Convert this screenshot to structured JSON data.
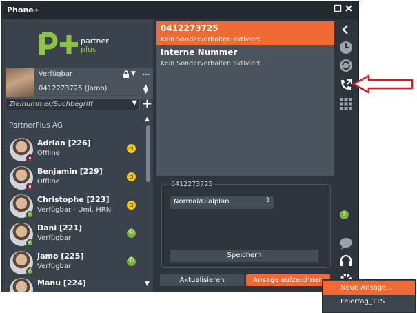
{
  "window": {
    "title": "Phone+",
    "maximize_icon": "maximize-icon",
    "close_icon": "close-icon"
  },
  "logo": {
    "line1": "partner",
    "line2": "plus",
    "colors": {
      "green": "#8bc53f"
    }
  },
  "profile": {
    "status": "Verfügbar",
    "number": "0412273725 (Jamo)",
    "more_label": "..."
  },
  "search": {
    "placeholder": "Zielnummer/Suchbegriff"
  },
  "add_label": "+",
  "group": {
    "label": "PartnerPlus AG"
  },
  "contacts": [
    {
      "name": "Adrian [226]",
      "status": "Offline",
      "presence": "offline",
      "action": "yellow"
    },
    {
      "name": "Benjamin [229]",
      "status": "Offline",
      "presence": "offline",
      "action": "yellow"
    },
    {
      "name": "Christophe [223]",
      "status": "Verfügbar - Uml. HRN",
      "presence": "online",
      "action": "yellow"
    },
    {
      "name": "Dani [221]",
      "status": "Verfügbar",
      "presence": "online",
      "action": "green"
    },
    {
      "name": "Jamo [225]",
      "status": "Verfügbar",
      "presence": "online",
      "action": "green"
    },
    {
      "name": "Manu [224]",
      "status": "",
      "presence": "online",
      "action": "none"
    }
  ],
  "list": [
    {
      "title": "0412273725",
      "subtitle": "Kein Sonderverhalten aktiviert",
      "selected": true
    },
    {
      "title": "Interne Nummer",
      "subtitle": "Kein Sonderverhalten aktiviert",
      "selected": false
    }
  ],
  "detail": {
    "legend": "0412273725",
    "select_value": "Normal/Dialplan",
    "save_label": "Speichern"
  },
  "buttons": {
    "update": "Aktualisieren",
    "record": "Ansage aufzeichnen"
  },
  "rail": {
    "badge_count": "2"
  },
  "popup": {
    "items": [
      "Neue Ansage...",
      "Feiertag_TTS"
    ]
  },
  "colors": {
    "accent": "#f26a33",
    "panel": "#2d343b",
    "green": "#7ab43a",
    "yellow": "#f1c40f",
    "annotation_red": "#e0161c"
  }
}
